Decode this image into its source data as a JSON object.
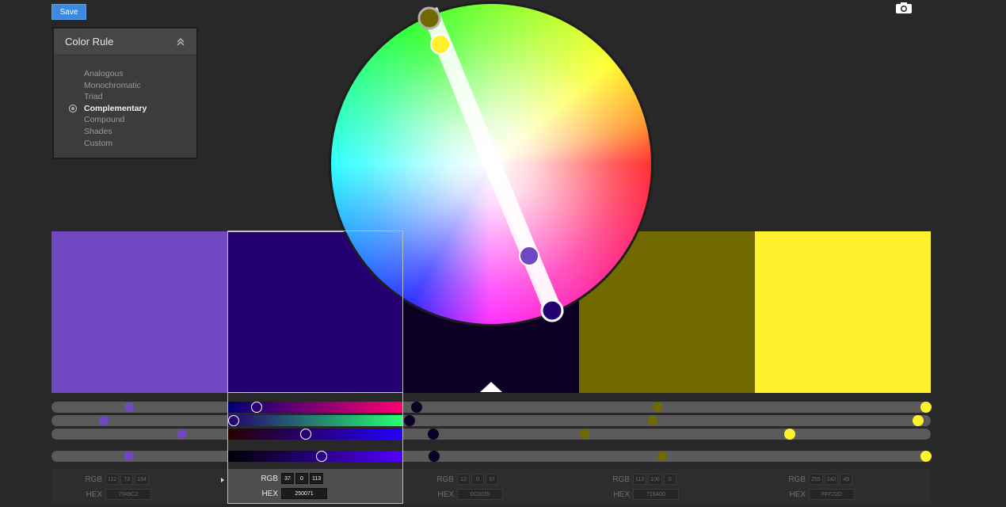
{
  "toolbar": {
    "save_label": "Save",
    "camera_icon": "camera-icon"
  },
  "color_rule": {
    "title": "Color Rule",
    "collapse_icon": "double-chevron-up-icon",
    "options": [
      "Analogous",
      "Monochromatic",
      "Triad",
      "Complementary",
      "Compound",
      "Shades",
      "Custom"
    ],
    "selected": "Complementary"
  },
  "swatches": [
    {
      "hex": "7049C2",
      "rgb": [
        "112",
        "73",
        "194"
      ]
    },
    {
      "hex": "250071",
      "rgb": [
        "37",
        "0",
        "113"
      ]
    },
    {
      "hex": "0C0025",
      "rgb": [
        "12",
        "0",
        "37"
      ]
    },
    {
      "hex": "716A00",
      "rgb": [
        "113",
        "106",
        "0"
      ]
    },
    {
      "hex": "FFF22D",
      "rgb": [
        "255",
        "242",
        "45"
      ]
    }
  ],
  "selected_swatch_index": 1,
  "base_swatch_index": 2,
  "labels": {
    "rgb": "RGB",
    "hex": "HEX"
  },
  "colors": {
    "accent": "#3d8be0",
    "background": "#282828",
    "panel": "#3c3c3c"
  }
}
